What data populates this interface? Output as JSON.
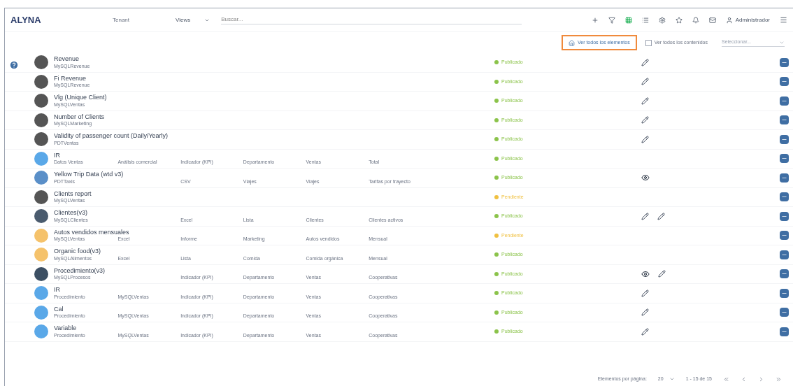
{
  "header": {
    "logo": "ALYNA",
    "tenant": "Tenant",
    "view": "Views",
    "search": {
      "placeholder": "Buscar..."
    },
    "user": "Administrador"
  },
  "toolbar": {
    "filter_button": "Ver todos los elementos",
    "all_contents": {
      "label": "Ver todos los contenidos",
      "checked": false
    },
    "date_select": "Seleccionar..."
  },
  "rows": [
    {
      "title": "Revenue",
      "source": "MySQLRevenue",
      "avatar": {
        "color": "#555555"
      },
      "cells": [],
      "status": {
        "label": "Publicado",
        "color": "#8bc34a"
      },
      "actions": [
        {
          "kind": "edit"
        }
      ]
    },
    {
      "title": "Fi Revenue",
      "source": "MySQLRevenue",
      "avatar": {
        "color": "#555555"
      },
      "cells": [],
      "status": {
        "label": "Publicado",
        "color": "#8bc34a"
      },
      "actions": [
        {
          "kind": "edit"
        }
      ]
    },
    {
      "title": "Vlg (Unique Client)",
      "source": "MySQLVentas",
      "avatar": {
        "color": "#555555"
      },
      "cells": [],
      "status": {
        "label": "Publicado",
        "color": "#8bc34a"
      },
      "actions": [
        {
          "kind": "edit"
        }
      ]
    },
    {
      "title": "Number of Clients",
      "source": "MySQLMarketing",
      "avatar": {
        "color": "#555555"
      },
      "cells": [],
      "status": {
        "label": "Publicado",
        "color": "#8bc34a"
      },
      "actions": [
        {
          "kind": "edit"
        }
      ]
    },
    {
      "title": "Validity of passenger count (Daily/Yearly)",
      "source": "PDTVentas",
      "avatar": {
        "color": "#555555"
      },
      "cells": [],
      "status": {
        "label": "Publicado",
        "color": "#8bc34a"
      },
      "actions": [
        {
          "kind": "edit"
        }
      ]
    },
    {
      "title": "IR",
      "source": "Datos Ventas",
      "avatar": {
        "color": "#5aa8e8"
      },
      "cells": [
        "Análisis comercial",
        "Indicador (KPI)",
        "Departamento",
        "Ventas",
        "Total"
      ],
      "status": {
        "label": "Publicado",
        "color": "#8bc34a"
      },
      "actions": []
    },
    {
      "title": "Yellow Trip Data (wtd v3)",
      "source": "PDTTaxis",
      "avatar": {
        "color": "#5a8fc8"
      },
      "cells": [
        "",
        "CSV",
        "Viajes",
        "Viajes",
        "Tarifas por trayecto"
      ],
      "status": {
        "label": "Publicado",
        "color": "#8bc34a"
      },
      "actions": [
        {
          "kind": "view"
        }
      ]
    },
    {
      "title": "Clients report",
      "source": "MySQLVentas",
      "avatar": {
        "color": "#555555"
      },
      "cells": [],
      "status": {
        "label": "Pendiente",
        "color": "#f0c040"
      },
      "actions": []
    },
    {
      "title": "Clientes(v3)",
      "source": "MySQLClientes",
      "avatar": {
        "color": "#4a5b6e"
      },
      "cells": [
        "",
        "Excel",
        "Lista",
        "Clientes",
        "Clientes activos"
      ],
      "status": {
        "label": "Publicado",
        "color": "#8bc34a"
      },
      "actions": [
        {
          "kind": "edit"
        },
        {
          "kind": "edit"
        }
      ]
    },
    {
      "title": "Autos vendidos mensuales",
      "source": "MySQLVentas",
      "avatar": {
        "color": "#f5c26b"
      },
      "cells": [
        "Excel",
        "Informe",
        "Marketing",
        "Autos vendidos",
        "Mensual"
      ],
      "status": {
        "label": "Pendiente",
        "color": "#f0c040"
      },
      "actions": []
    },
    {
      "title": "Organic food(v3)",
      "source": "MySQLAlimentos",
      "avatar": {
        "color": "#f5c26b"
      },
      "cells": [
        "Excel",
        "Lista",
        "Comida",
        "Comida orgánica",
        "Mensual"
      ],
      "status": {
        "label": "Publicado",
        "color": "#8bc34a"
      },
      "actions": []
    },
    {
      "title": "Procedimiento(v3)",
      "source": "MySQLProcesos",
      "avatar": {
        "color": "#3c4f63"
      },
      "cells": [
        "",
        "Indicador (KPI)",
        "Departamento",
        "Ventas",
        "Cooperativas"
      ],
      "status": {
        "label": "Publicado",
        "color": "#8bc34a"
      },
      "actions": [
        {
          "kind": "view"
        },
        {
          "kind": "edit"
        }
      ]
    },
    {
      "title": "IR",
      "source": "Procedimiento",
      "avatar": {
        "color": "#5aa8e8"
      },
      "cells": [
        "MySQLVentas",
        "Indicador (KPI)",
        "Departamento",
        "Ventas",
        "Cooperativas"
      ],
      "status": {
        "label": "Publicado",
        "color": "#8bc34a"
      },
      "actions": [
        {
          "kind": "edit"
        }
      ]
    },
    {
      "title": "Cal",
      "source": "Procedimiento",
      "avatar": {
        "color": "#5aa8e8"
      },
      "cells": [
        "MySQLVentas",
        "Indicador (KPI)",
        "Departamento",
        "Ventas",
        "Cooperativas"
      ],
      "status": {
        "label": "Publicado",
        "color": "#8bc34a"
      },
      "actions": [
        {
          "kind": "edit"
        }
      ]
    },
    {
      "title": "Variable",
      "source": "Procedimiento",
      "avatar": {
        "color": "#5aa8e8"
      },
      "cells": [
        "MySQLVentas",
        "Indicador (KPI)",
        "Departamento",
        "Ventas",
        "Cooperativas"
      ],
      "status": {
        "label": "Publicado",
        "color": "#8bc34a"
      },
      "actions": [
        {
          "kind": "edit"
        }
      ]
    }
  ],
  "pagination": {
    "per_page_label": "Elementos por página:",
    "per_page": "20",
    "range": "1 - 15 de 15"
  }
}
